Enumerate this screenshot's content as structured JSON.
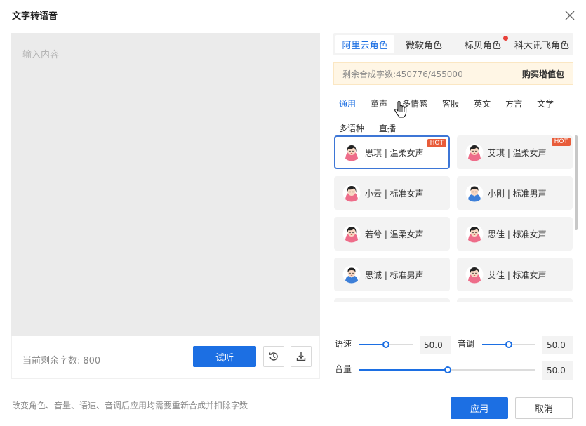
{
  "dialog": {
    "title": "文字转语音",
    "close_icon": "close-icon"
  },
  "editor": {
    "placeholder": "输入内容",
    "remaining_label": "当前剩余字数:",
    "remaining_count": "800"
  },
  "actions": {
    "listen_label": "试听",
    "history_icon": "history-icon",
    "download_icon": "download-icon"
  },
  "tabs": [
    {
      "label": "阿里云角色",
      "active": true,
      "dot": false
    },
    {
      "label": "微软角色",
      "active": false,
      "dot": false
    },
    {
      "label": "标贝角色",
      "active": false,
      "dot": true
    },
    {
      "label": "科大讯飞角色",
      "active": false,
      "dot": false
    }
  ],
  "quota": {
    "text": "剩余合成字数:450776/455000",
    "buy_label": "购买增值包"
  },
  "categories": [
    {
      "label": "通用",
      "active": true
    },
    {
      "label": "童声",
      "active": false
    },
    {
      "label": "多情感",
      "active": false
    },
    {
      "label": "客服",
      "active": false
    },
    {
      "label": "英文",
      "active": false
    },
    {
      "label": "方言",
      "active": false
    },
    {
      "label": "文学",
      "active": false
    },
    {
      "label": "多语种",
      "active": false
    },
    {
      "label": "直播",
      "active": false
    }
  ],
  "voices": [
    {
      "name": "思琪 | 温柔女声",
      "gender": "female",
      "hot": "HOT",
      "selected": true
    },
    {
      "name": "艾琪 | 温柔女声",
      "gender": "female",
      "hot": "HOT",
      "selected": false
    },
    {
      "name": "小云 | 标准女声",
      "gender": "female",
      "hot": "",
      "selected": false
    },
    {
      "name": "小刚 | 标准男声",
      "gender": "male",
      "hot": "",
      "selected": false
    },
    {
      "name": "若兮 | 温柔女声",
      "gender": "female",
      "hot": "",
      "selected": false
    },
    {
      "name": "思佳 | 标准女声",
      "gender": "female",
      "hot": "",
      "selected": false
    },
    {
      "name": "思诚 | 标准男声",
      "gender": "male",
      "hot": "",
      "selected": false
    },
    {
      "name": "艾佳 | 标准女声",
      "gender": "female",
      "hot": "",
      "selected": false
    }
  ],
  "sliders": {
    "speed": {
      "label": "语速",
      "value": "50.0",
      "level": 0.5
    },
    "pitch": {
      "label": "音调",
      "value": "50.0",
      "level": 0.5
    },
    "volume": {
      "label": "音量",
      "value": "50.0",
      "level": 0.5
    }
  },
  "footer": {
    "note": "改变角色、音量、语速、音调后应用均需要重新合成并扣除字数",
    "apply_label": "应用",
    "cancel_label": "取消"
  },
  "colors": {
    "accent": "#1c6fe3",
    "hot": "#e85c3a",
    "quota_bg": "#fff6e5"
  }
}
